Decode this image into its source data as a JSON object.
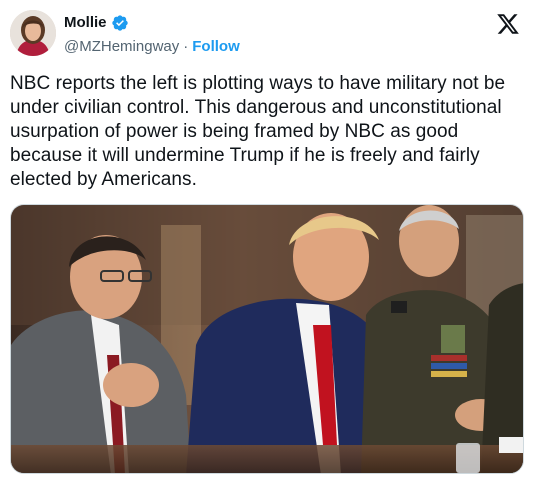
{
  "author": {
    "display_name": "Mollie",
    "handle": "@MZHemingway",
    "separator": "·",
    "follow_label": "Follow",
    "verified_icon": "verified-badge-icon",
    "verified_color": "#1d9bf0"
  },
  "brand": {
    "logo_icon": "x-logo-icon"
  },
  "tweet": {
    "text": "NBC reports the left is plotting ways to have military not be under civilian control. This dangerous and unconstitutional usurpation of power is being framed by NBC as good because it will undermine Trump if he is freely and fairly elected by Americans."
  },
  "colors": {
    "text": "#0f1419",
    "secondary": "#536471",
    "link": "#1d9bf0"
  }
}
